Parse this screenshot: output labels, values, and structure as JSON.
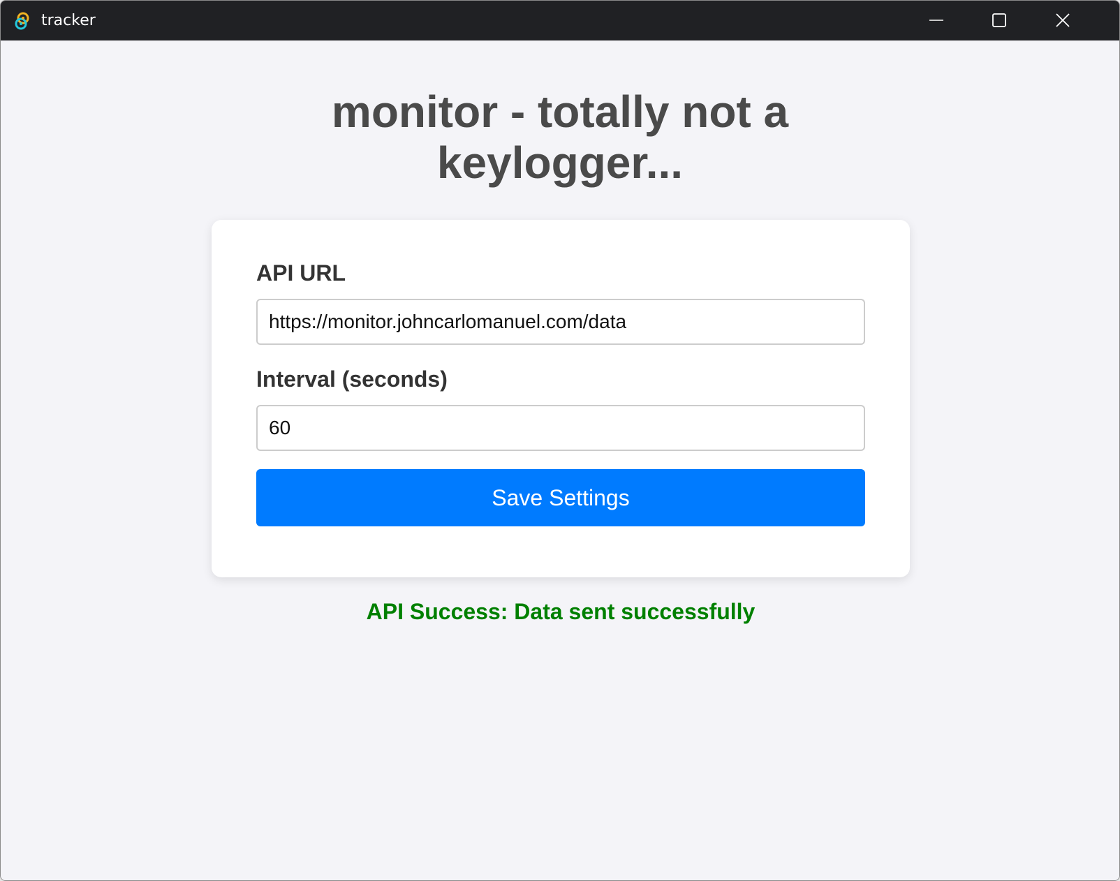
{
  "window": {
    "title": "tracker",
    "app_icon": "tauri-app-icon",
    "controls": {
      "minimize_icon": "minimize-icon",
      "maximize_icon": "maximize-icon",
      "close_icon": "close-icon"
    }
  },
  "page": {
    "title": "monitor - totally not a keylogger..."
  },
  "form": {
    "api_url_label": "API URL",
    "api_url_value": "https://monitor.johncarlomanuel.com/data",
    "interval_label": "Interval (seconds)",
    "interval_value": "60",
    "save_button_label": "Save Settings"
  },
  "status": {
    "message": "API Success: Data sent successfully",
    "color": "#008000"
  },
  "colors": {
    "accent": "#007bff",
    "titlebar": "#202124",
    "background": "#f4f4f8",
    "heading": "#4a4a4a"
  }
}
